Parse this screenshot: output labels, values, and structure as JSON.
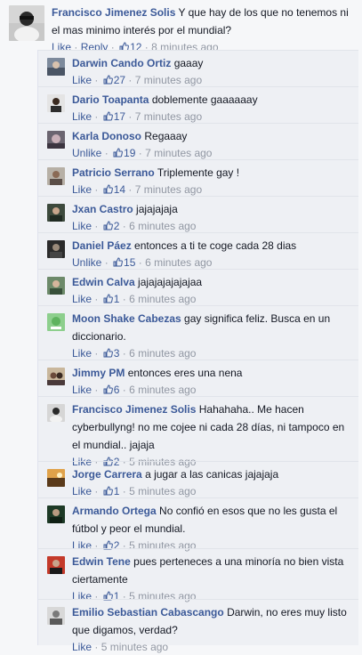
{
  "top_comment": {
    "author": "Francisco Jimenez Solis",
    "text": "Y que hay de los que no tenemos ni el mas minimo interés por el mundial?",
    "action": "Like",
    "reply": "Reply",
    "likes": "12",
    "time": "8 minutes ago",
    "avatar_icon": "profile-photo"
  },
  "replies": [
    {
      "author": "Darwin Cando Ortiz",
      "text": "gaaay",
      "action": "Like",
      "likes": "27",
      "time": "7 minutes ago"
    },
    {
      "author": "Dario Toapanta",
      "text": "doblemente gaaaaaay",
      "action": "Like",
      "likes": "17",
      "time": "7 minutes ago"
    },
    {
      "author": "Karla Donoso",
      "text": "Regaaay",
      "action": "Unlike",
      "likes": "19",
      "time": "7 minutes ago"
    },
    {
      "author": "Patricio Serrano",
      "text": "Triplemente gay !",
      "action": "Like",
      "likes": "14",
      "time": "7 minutes ago"
    },
    {
      "author": "Jxan Castro",
      "text": "jajajajaja",
      "action": "Like",
      "likes": "2",
      "time": "6 minutes ago"
    },
    {
      "author": "Daniel Páez",
      "text": "entonces a ti te coge cada 28 dias",
      "action": "Unlike",
      "likes": "15",
      "time": "6 minutes ago"
    },
    {
      "author": "Edwin Calva",
      "text": "jajajajajajajaa",
      "action": "Like",
      "likes": "1",
      "time": "6 minutes ago"
    },
    {
      "author": "Moon Shake Cabezas",
      "text": "gay significa feliz. Busca en un diccionario.",
      "action": "Like",
      "likes": "3",
      "time": "6 minutes ago"
    },
    {
      "author": "Jimmy PM",
      "text": "entonces eres una nena",
      "action": "Like",
      "likes": "6",
      "time": "6 minutes ago"
    },
    {
      "author": "Francisco Jimenez Solis",
      "text": "Hahahaha.. Me hacen cyberbullyng! no me cojee ni cada 28 días, ni tampoco en el mundial.. jajaja",
      "action": "Like",
      "likes": "2",
      "time": "5 minutes ago"
    },
    {
      "author": "Jorge Carrera",
      "text": "a jugar a las canicas jajajaja",
      "action": "Like",
      "likes": "1",
      "time": "5 minutes ago"
    },
    {
      "author": "Armando Ortega",
      "text": "No confió en esos que no les gusta el fútbol y peor el mundial.",
      "action": "Like",
      "likes": "2",
      "time": "5 minutes ago"
    },
    {
      "author": "Edwin Tene",
      "text": "pues perteneces a una minoría no bien vista ciertamente",
      "action": "Like",
      "likes": "1",
      "time": "5 minutes ago"
    },
    {
      "author": "Emilio Sebastian Cabascango",
      "text": "Darwin, no eres muy listo que digamos, verdad?",
      "action": "Like",
      "likes": null,
      "time": "5 minutes ago"
    }
  ],
  "colors": {
    "link": "#3b5998",
    "meta": "#9197a3",
    "background": "#f6f7f9",
    "reply_background": "#eef0f4"
  },
  "icons": {
    "like": "thumbs-up-icon"
  }
}
